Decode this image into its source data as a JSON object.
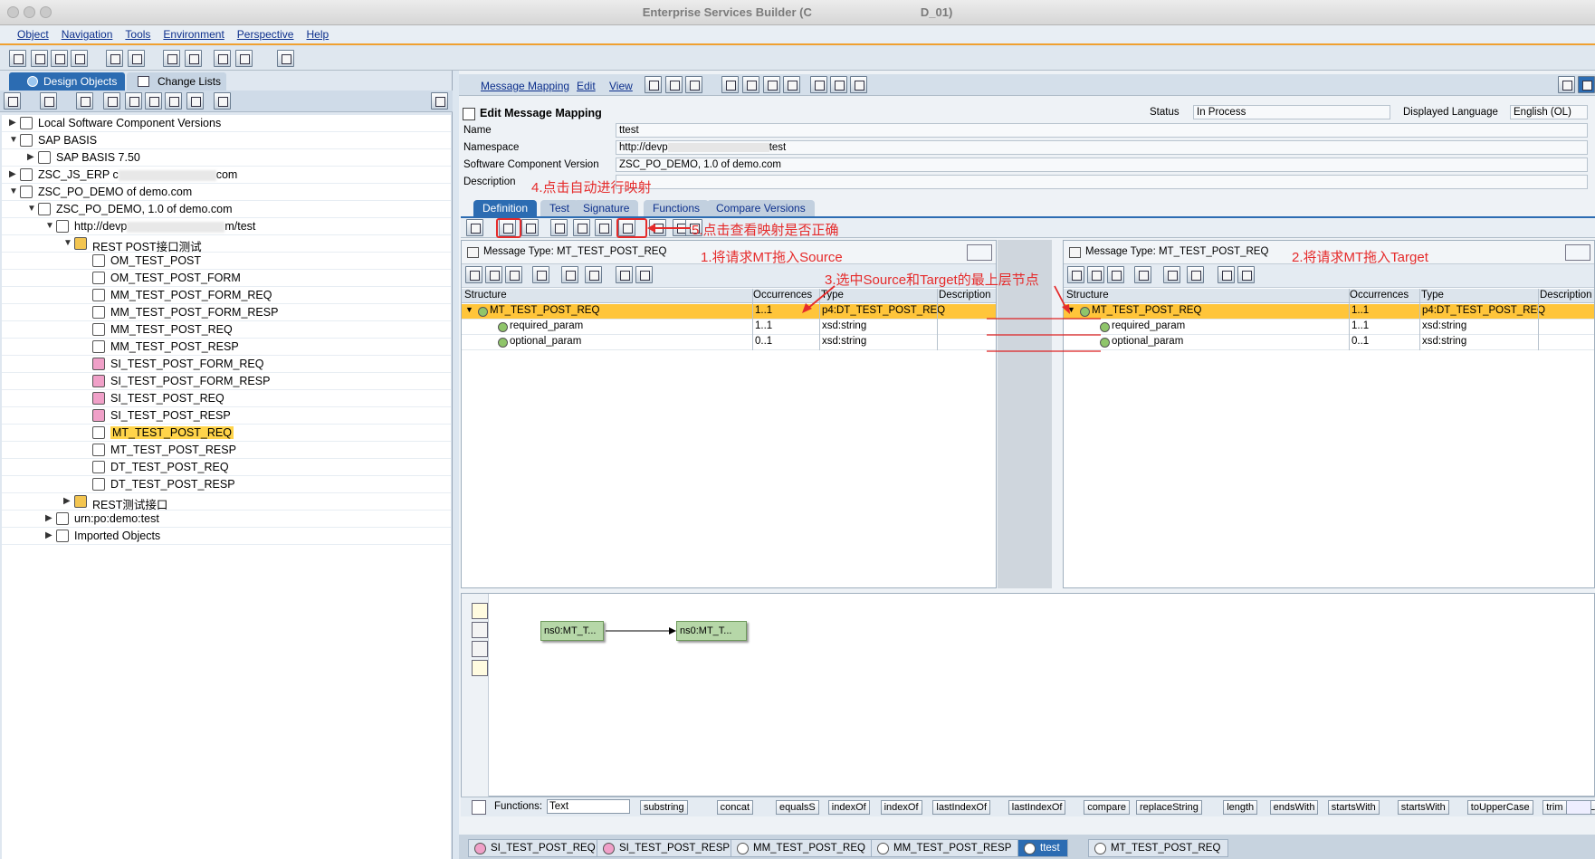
{
  "window": {
    "title": "Enterprise Services Builder (C",
    "title_suffix": "D_01)"
  },
  "menu": [
    "Object",
    "Navigation",
    "Tools",
    "Environment",
    "Perspective",
    "Help"
  ],
  "left": {
    "tabs": [
      "Design Objects",
      "Change Lists"
    ],
    "tree": [
      {
        "label": "Local Software Component Versions",
        "indent": 0,
        "arrow": "▶"
      },
      {
        "label": "SAP BASIS",
        "indent": 0,
        "arrow": "▼"
      },
      {
        "label": "SAP BASIS 7.50",
        "indent": 1,
        "arrow": "▶"
      },
      {
        "label": "ZSC_JS_ERP c",
        "label2": "com",
        "indent": 0,
        "arrow": "▶"
      },
      {
        "label": "ZSC_PO_DEMO of demo.com",
        "indent": 0,
        "arrow": "▼"
      },
      {
        "label": "ZSC_PO_DEMO, 1.0 of demo.com",
        "indent": 1,
        "arrow": "▼"
      },
      {
        "label": "http://devp",
        "label2": "m/test",
        "indent": 2,
        "arrow": "▼"
      },
      {
        "label": "REST POST接口测试",
        "indent": 3,
        "arrow": "▼"
      },
      {
        "label": "OM_TEST_POST",
        "indent": 4
      },
      {
        "label": "OM_TEST_POST_FORM",
        "indent": 4
      },
      {
        "label": "MM_TEST_POST_FORM_REQ",
        "indent": 4
      },
      {
        "label": "MM_TEST_POST_FORM_RESP",
        "indent": 4
      },
      {
        "label": "MM_TEST_POST_REQ",
        "indent": 4
      },
      {
        "label": "MM_TEST_POST_RESP",
        "indent": 4
      },
      {
        "label": "SI_TEST_POST_FORM_REQ",
        "indent": 4
      },
      {
        "label": "SI_TEST_POST_FORM_RESP",
        "indent": 4
      },
      {
        "label": "SI_TEST_POST_REQ",
        "indent": 4
      },
      {
        "label": "SI_TEST_POST_RESP",
        "indent": 4
      },
      {
        "label": "MT_TEST_POST_REQ",
        "indent": 4,
        "selected": true
      },
      {
        "label": "MT_TEST_POST_RESP",
        "indent": 4
      },
      {
        "label": "DT_TEST_POST_REQ",
        "indent": 4
      },
      {
        "label": "DT_TEST_POST_RESP",
        "indent": 4
      },
      {
        "label": "REST测试接口",
        "indent": 3,
        "arrow": "▶"
      },
      {
        "label": "urn:po:demo:test",
        "indent": 2,
        "arrow": "▶"
      },
      {
        "label": "Imported Objects",
        "indent": 2,
        "arrow": "▶"
      }
    ]
  },
  "right": {
    "toolbar_links": [
      "Message Mapping",
      "Edit",
      "View"
    ],
    "heading": "Edit Message Mapping",
    "status_label": "Status",
    "status_value": "In Process",
    "lang_label": "Displayed Language",
    "lang_value": "English (OL)",
    "name_label": "Name",
    "name_value": "ttest",
    "ns_label": "Namespace",
    "ns_value": "http://devp",
    "ns_value2": "test",
    "scv_label": "Software Component Version",
    "scv_value": "ZSC_PO_DEMO, 1.0 of demo.com",
    "desc_label": "Description",
    "desc_value": "",
    "tabs": [
      "Definition",
      "Test",
      "Signature",
      "Functions",
      "Compare Versions"
    ],
    "source": {
      "title": "Message Type: MT_TEST_POST_REQ",
      "cols": [
        "Structure",
        "Occurrences",
        "Type",
        "Description"
      ],
      "rows": [
        {
          "name": "MT_TEST_POST_REQ",
          "occ": "1..1",
          "type": "p4:DT_TEST_POST_REQ"
        },
        {
          "name": "required_param",
          "occ": "1..1",
          "type": "xsd:string"
        },
        {
          "name": "optional_param",
          "occ": "0..1",
          "type": "xsd:string"
        }
      ]
    },
    "target": {
      "title": "Message Type: MT_TEST_POST_REQ",
      "cols": [
        "Structure",
        "Occurrences",
        "Type",
        "Description"
      ],
      "rows": [
        {
          "name": "MT_TEST_POST_REQ",
          "occ": "1..1",
          "type": "p4:DT_TEST_POST_REQ"
        },
        {
          "name": "required_param",
          "occ": "1..1",
          "type": "xsd:string"
        },
        {
          "name": "optional_param",
          "occ": "0..1",
          "type": "xsd:string"
        }
      ]
    },
    "nodes": [
      "ns0:MT_T...",
      "ns0:MT_T..."
    ],
    "functions_label": "Functions:",
    "functions_value": "Text",
    "function_buttons": [
      "substring",
      "concat",
      "equalsS",
      "indexOf",
      "indexOf",
      "lastIndexOf",
      "lastIndexOf",
      "compare",
      "replaceString",
      "length",
      "endsWith",
      "startsWith",
      "startsWith",
      "toUpperCase",
      "trim",
      "toLowerCase"
    ],
    "bottom_tabs": [
      "SI_TEST_POST_REQ",
      "SI_TEST_POST_RESP",
      "MM_TEST_POST_REQ",
      "MM_TEST_POST_RESP",
      "ttest",
      "MT_TEST_POST_REQ"
    ]
  },
  "annotations": {
    "a1": "1.将请求MT拖入Source",
    "a2": "2.将请求MT拖入Target",
    "a3": "3.选中Source和Target的最上层节点",
    "a4": "4.点击自动进行映射",
    "a5": "5.点击查看映射是否正确"
  },
  "colors": {
    "accent": "#2c6cb2",
    "highlight": "#ffc53a",
    "annotation": "#e52b2b",
    "node": "#b6d7a8"
  }
}
